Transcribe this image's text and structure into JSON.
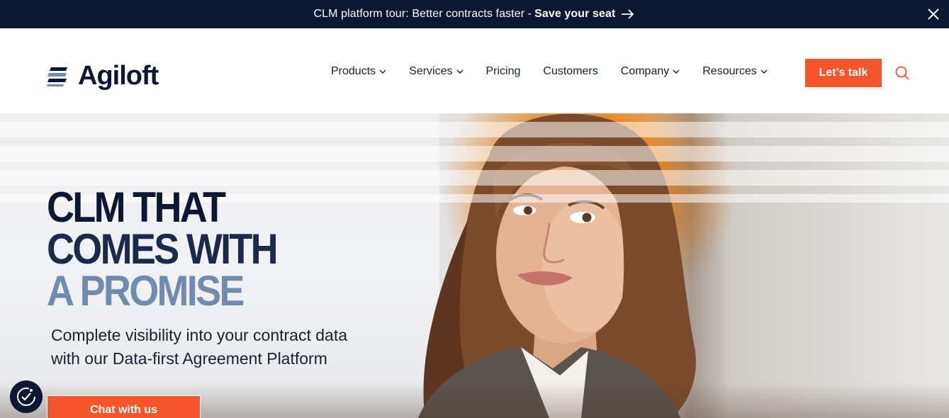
{
  "announcement": {
    "text": "CLM platform tour: Better contracts faster - ",
    "cta": "Save your seat",
    "close_icon": "close-icon",
    "arrow_icon": "arrow-right-icon"
  },
  "header": {
    "logo_text": "Agiloft",
    "nav": [
      {
        "label": "Products",
        "has_dropdown": true
      },
      {
        "label": "Services",
        "has_dropdown": true
      },
      {
        "label": "Pricing",
        "has_dropdown": false
      },
      {
        "label": "Customers",
        "has_dropdown": false
      },
      {
        "label": "Company",
        "has_dropdown": true
      },
      {
        "label": "Resources",
        "has_dropdown": true
      }
    ],
    "cta_label": "Let’s talk",
    "search_icon": "search-icon"
  },
  "hero": {
    "headline_line1": "CLM THAT",
    "headline_line2": "COMES WITH",
    "headline_line3": "A PROMISE",
    "subhead_line1": "Complete visibility into your contract data",
    "subhead_line2": "with our Data-first Agreement Platform",
    "chat_button": "Chat with us"
  },
  "colors": {
    "navy": "#0b1733",
    "accent": "#f4552a",
    "headline_light": "#6f8cb0"
  },
  "consent_icon": "cookie-consent-icon"
}
